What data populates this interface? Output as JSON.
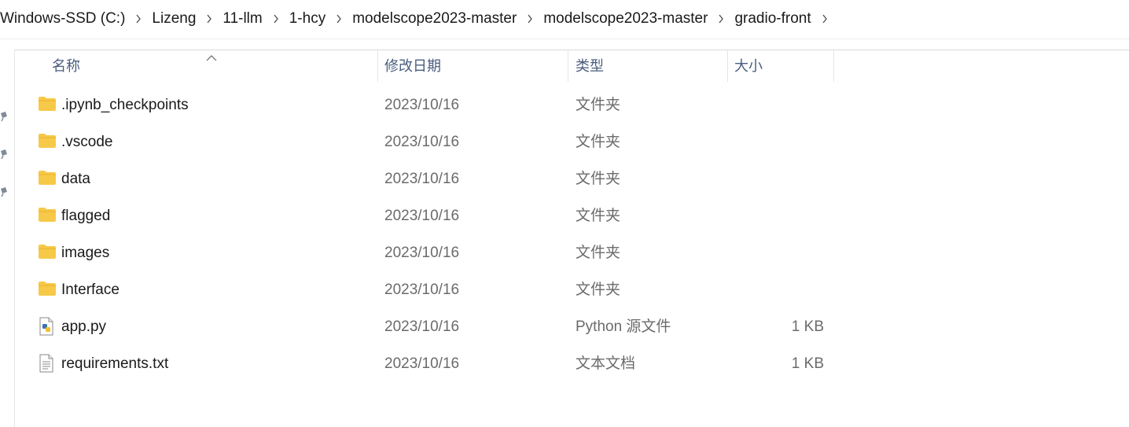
{
  "breadcrumb": {
    "items": [
      "Windows-SSD (C:)",
      "Lizeng",
      "11-llm",
      "1-hcy",
      "modelscope2023-master",
      "modelscope2023-master",
      "gradio-front"
    ]
  },
  "columns": {
    "name": "名称",
    "date": "修改日期",
    "type": "类型",
    "size": "大小"
  },
  "files": [
    {
      "name": ".ipynb_checkpoints",
      "date": "2023/10/16",
      "type": "文件夹",
      "size": "",
      "icon": "folder-icon"
    },
    {
      "name": ".vscode",
      "date": "2023/10/16",
      "type": "文件夹",
      "size": "",
      "icon": "folder-icon"
    },
    {
      "name": "data",
      "date": "2023/10/16",
      "type": "文件夹",
      "size": "",
      "icon": "folder-icon"
    },
    {
      "name": "flagged",
      "date": "2023/10/16",
      "type": "文件夹",
      "size": "",
      "icon": "folder-icon"
    },
    {
      "name": "images",
      "date": "2023/10/16",
      "type": "文件夹",
      "size": "",
      "icon": "folder-icon"
    },
    {
      "name": "Interface",
      "date": "2023/10/16",
      "type": "文件夹",
      "size": "",
      "icon": "folder-icon"
    },
    {
      "name": "app.py",
      "date": "2023/10/16",
      "type": "Python 源文件",
      "size": "1 KB",
      "icon": "python-file-icon"
    },
    {
      "name": "requirements.txt",
      "date": "2023/10/16",
      "type": "文本文档",
      "size": "1 KB",
      "icon": "text-file-icon"
    }
  ],
  "colors": {
    "folder": "#f7c948",
    "header_text": "#4a5d7e",
    "secondary_text": "#6b6b6b"
  }
}
